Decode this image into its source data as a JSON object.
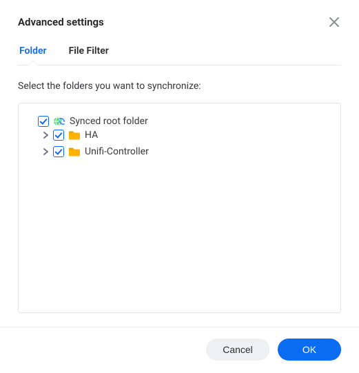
{
  "dialog": {
    "title": "Advanced settings"
  },
  "tabs": {
    "folder": "Folder",
    "file_filter": "File Filter"
  },
  "instruction": "Select the folders you want to synchronize:",
  "tree": {
    "root": {
      "label": "Synced root folder",
      "checked": true,
      "children": [
        {
          "label": "HA",
          "checked": true
        },
        {
          "label": "Unifi-Controller",
          "checked": true
        }
      ]
    }
  },
  "buttons": {
    "cancel": "Cancel",
    "ok": "OK"
  }
}
